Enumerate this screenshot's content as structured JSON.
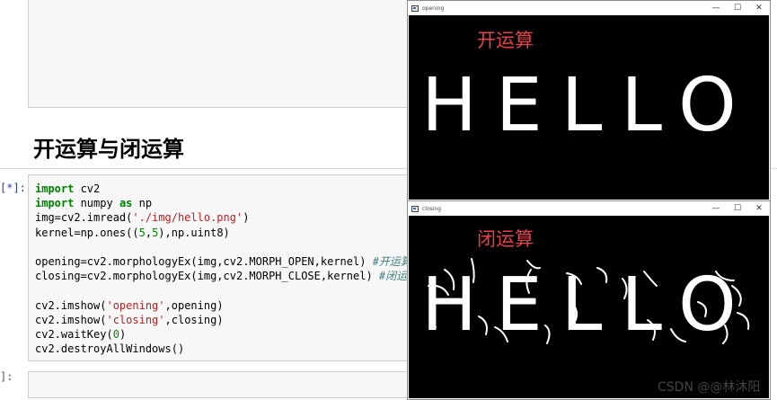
{
  "notebook": {
    "heading": "开运算与闭运算",
    "prompt_main": "[*]:",
    "prompt_next": "]:",
    "code": {
      "l1_kw": "import",
      "l1_rest": " cv2",
      "l2_kw": "import",
      "l2_mod": " numpy ",
      "l2_as": "as",
      "l2_alias": " np",
      "l3_a": "img=cv2.imread(",
      "l3_str": "'./img/hello.png'",
      "l3_b": ")",
      "l4_a": "kernel=np.ones((",
      "l4_n1": "5",
      "l4_c": ",",
      "l4_n2": "5",
      "l4_b": "),np.uint8)",
      "l6_a": "opening=cv2.morphologyEx(img,cv2.MORPH_OPEN,kernel) ",
      "l6_cm": "#开运算",
      "l7_a": "closing=cv2.morphologyEx(img,cv2.MORPH_CLOSE,kernel) ",
      "l7_cm": "#闭运算",
      "l9_a": "cv2.imshow(",
      "l9_str": "'opening'",
      "l9_b": ",opening)",
      "l10_a": "cv2.imshow(",
      "l10_str": "'closing'",
      "l10_b": ",closing)",
      "l11_a": "cv2.waitKey(",
      "l11_n": "0",
      "l11_b": ")",
      "l12": "cv2.destroyAllWindows()"
    }
  },
  "windows": {
    "opening": {
      "title": "opening",
      "label": "开运算",
      "image_text": "HELLO"
    },
    "closing": {
      "title": "closing",
      "label": "闭运算",
      "image_text": "HELLO"
    },
    "controls": {
      "minimize": "—",
      "maximize": "☐",
      "close": "✕"
    }
  },
  "watermark": "CSDN @@林沐阳",
  "colors": {
    "label_red": "#e8404a",
    "keyword_green": "#008000",
    "string_red": "#ba2121",
    "prompt_blue": "#303f9f"
  }
}
